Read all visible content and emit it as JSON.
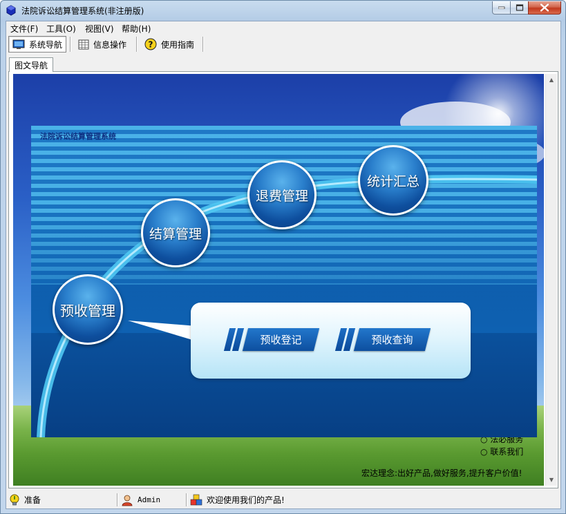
{
  "window": {
    "title": "法院诉讼结算管理系统(非注册版)"
  },
  "menu": [
    {
      "label": "文件(F)"
    },
    {
      "label": "工具(O)"
    },
    {
      "label": "视图(V)"
    },
    {
      "label": "帮助(H)"
    }
  ],
  "toolbar": [
    {
      "label": "系统导航",
      "icon": "monitor-icon",
      "active": true
    },
    {
      "label": "信息操作",
      "icon": "grid-icon",
      "active": false
    },
    {
      "label": "使用指南",
      "icon": "help-icon",
      "active": false
    }
  ],
  "tab": {
    "label": "图文导航"
  },
  "panel": {
    "title": "法院诉讼结算管理系统",
    "modules": [
      {
        "label": "预收管理"
      },
      {
        "label": "结算管理"
      },
      {
        "label": "退费管理"
      },
      {
        "label": "统计汇总"
      }
    ],
    "actions": [
      {
        "label": "预收登记"
      },
      {
        "label": "预收查询"
      }
    ]
  },
  "background_text": {
    "links": [
      {
        "label": "○ 法必服务"
      },
      {
        "label": "○ 联系我们"
      }
    ],
    "slogan": "宏达理念:出好产品,做好服务,提升客户价值!"
  },
  "status": {
    "ready": "准备",
    "user": "Admin",
    "message": "欢迎使用我们的产品!"
  },
  "colors": {
    "panel_blue": "#0f63b4",
    "orb_blue": "#2a7fcc",
    "title_blue": "#0d2e80"
  }
}
